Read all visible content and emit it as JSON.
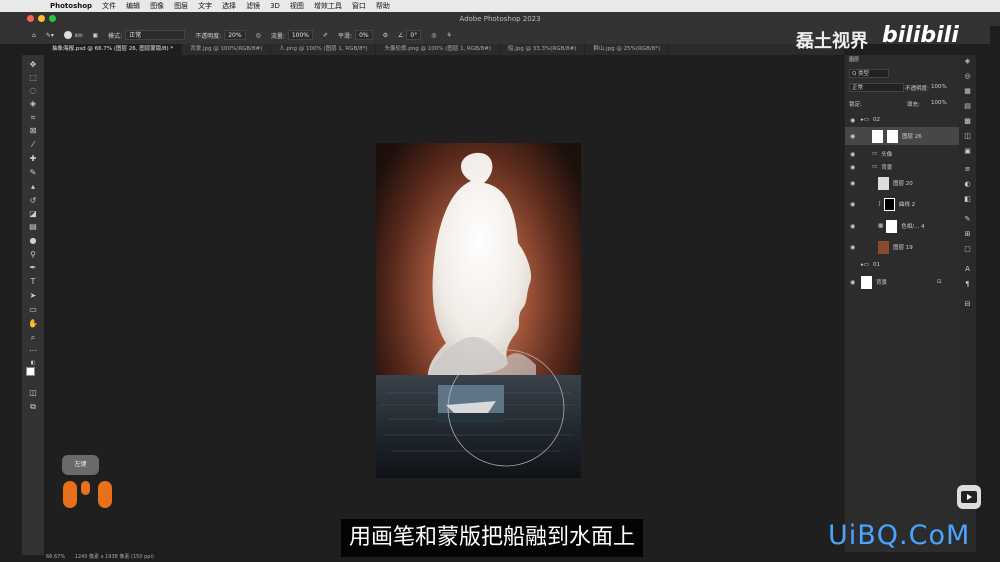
{
  "menubar": {
    "app": "Photoshop",
    "items": [
      "文件",
      "编辑",
      "图像",
      "图层",
      "文字",
      "选择",
      "滤镜",
      "3D",
      "视图",
      "增效工具",
      "窗口",
      "帮助"
    ]
  },
  "window": {
    "title": "Adobe Photoshop 2023"
  },
  "options": {
    "brush_size": "800",
    "mode_label": "模式:",
    "mode_value": "正常",
    "opacity_label": "不透明度:",
    "opacity_value": "20%",
    "flow_label": "流量:",
    "flow_value": "100%",
    "smoothing_label": "平滑:",
    "smoothing_value": "0%",
    "angle_value": "0°"
  },
  "tabs": [
    "抽象海报.psd @ 66.7% (图层 26, 图层蒙版/8) *",
    "背景.jpg @ 100%(RGB/8#)",
    "人.png @ 100% (图层 1, RGB/8*)",
    "头像轮廓.png @ 100% (图层 1, RGB/8#)",
    "船.jpg @ 33.3%(RGB/8#)",
    "群山.jpg @ 25%(RGB/8*)"
  ],
  "layers_panel": {
    "tab_label": "图层",
    "filter_label": "Q 类型",
    "blend_mode": "正常",
    "opacity_label": "不透明度:",
    "opacity_value": "100%",
    "lock_label": "锁定:",
    "fill_label": "填充:",
    "fill_value": "100%",
    "layers": [
      {
        "name": "02",
        "type": "group"
      },
      {
        "name": "图层 26",
        "type": "layer"
      },
      {
        "name": "头像",
        "type": "group"
      },
      {
        "name": "背景",
        "type": "group"
      },
      {
        "name": "图层 20",
        "type": "layer"
      },
      {
        "name": "曲线 2",
        "type": "adjustment"
      },
      {
        "name": "色相/... 4",
        "type": "adjustment"
      },
      {
        "name": "图层 19",
        "type": "layer"
      },
      {
        "name": "01",
        "type": "group"
      },
      {
        "name": "背景",
        "type": "layer"
      }
    ]
  },
  "status": {
    "zoom": "66.67%",
    "doc_info": "1240 像素 x 1938 像素 (150 ppi)"
  },
  "overlays": {
    "subtitle": "用画笔和蒙版把船融到水面上",
    "watermark": "磊土视界",
    "bili": "bilibili",
    "site": "UiBQ.CoM",
    "key_hint": "左键"
  },
  "colors": {
    "accent": "#e8701a",
    "site_blue": "#4aa4ff"
  }
}
